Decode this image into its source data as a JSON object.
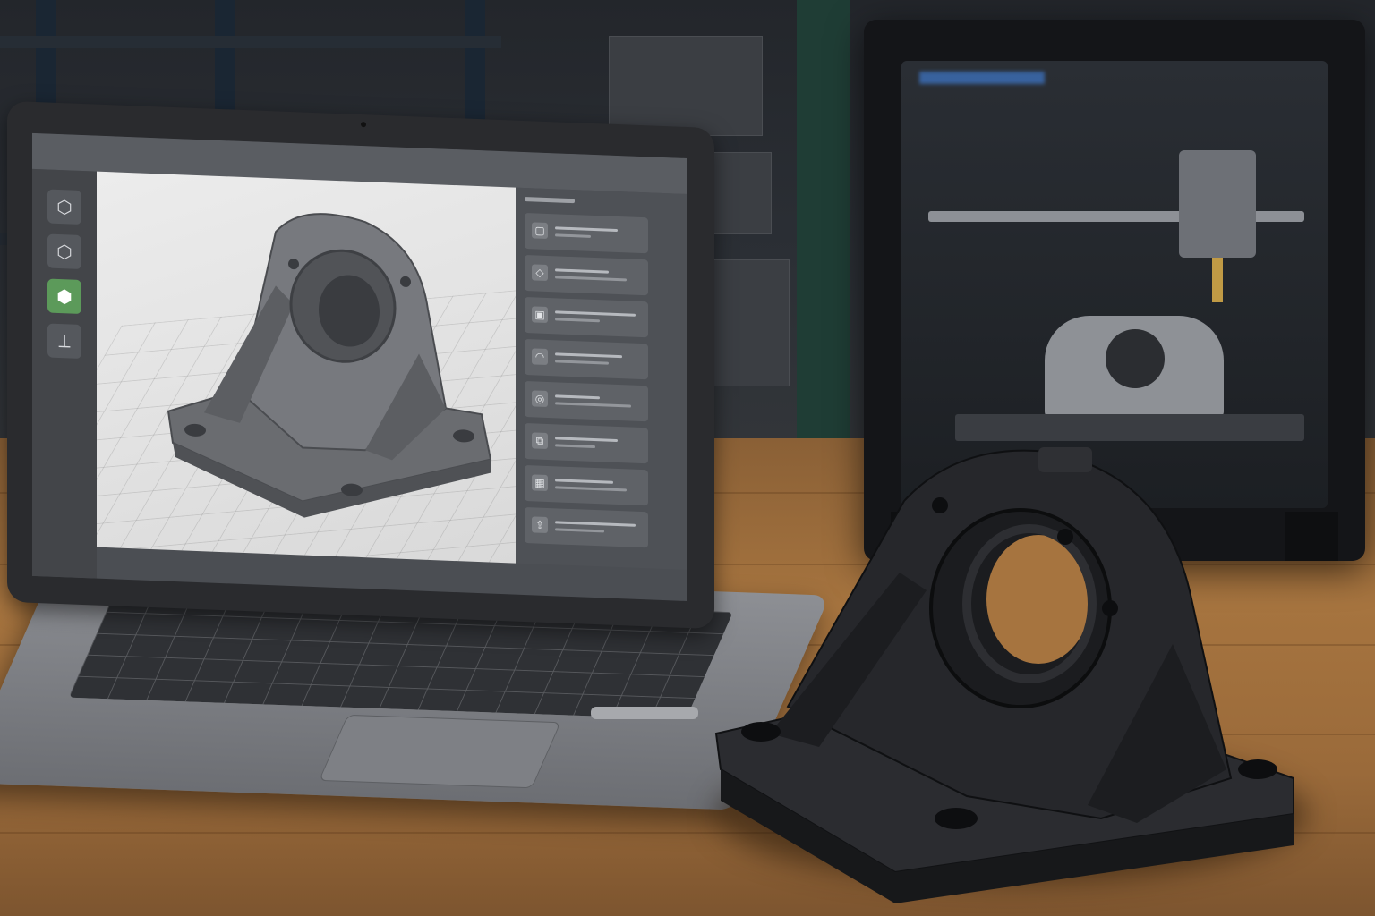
{
  "scene": {
    "palette": {
      "table_wood": "#a6743f",
      "laptop_aluminum": "#8d8f94",
      "printed_part_black": "#1f2023",
      "screen_accent_green": "#5c9a5a",
      "printer_frame": "#141518"
    }
  },
  "cad_app": {
    "tools": [
      {
        "icon": "cube-outline-icon",
        "glyph": "⬡",
        "active": false
      },
      {
        "icon": "cube-wireframe-icon",
        "glyph": "⬡",
        "active": false
      },
      {
        "icon": "cube-solid-icon",
        "glyph": "⬢",
        "active": true
      },
      {
        "icon": "measure-tool-icon",
        "glyph": "⟂",
        "active": false
      }
    ],
    "panel_rows": [
      {
        "icon": "layer-icon",
        "glyph": "▢"
      },
      {
        "icon": "sketch-icon",
        "glyph": "◇"
      },
      {
        "icon": "extrude-icon",
        "glyph": "▣"
      },
      {
        "icon": "fillet-icon",
        "glyph": "◠"
      },
      {
        "icon": "hole-icon",
        "glyph": "◎"
      },
      {
        "icon": "mirror-icon",
        "glyph": "⧉"
      },
      {
        "icon": "pattern-icon",
        "glyph": "▦"
      },
      {
        "icon": "export-icon",
        "glyph": "⇪"
      }
    ]
  }
}
